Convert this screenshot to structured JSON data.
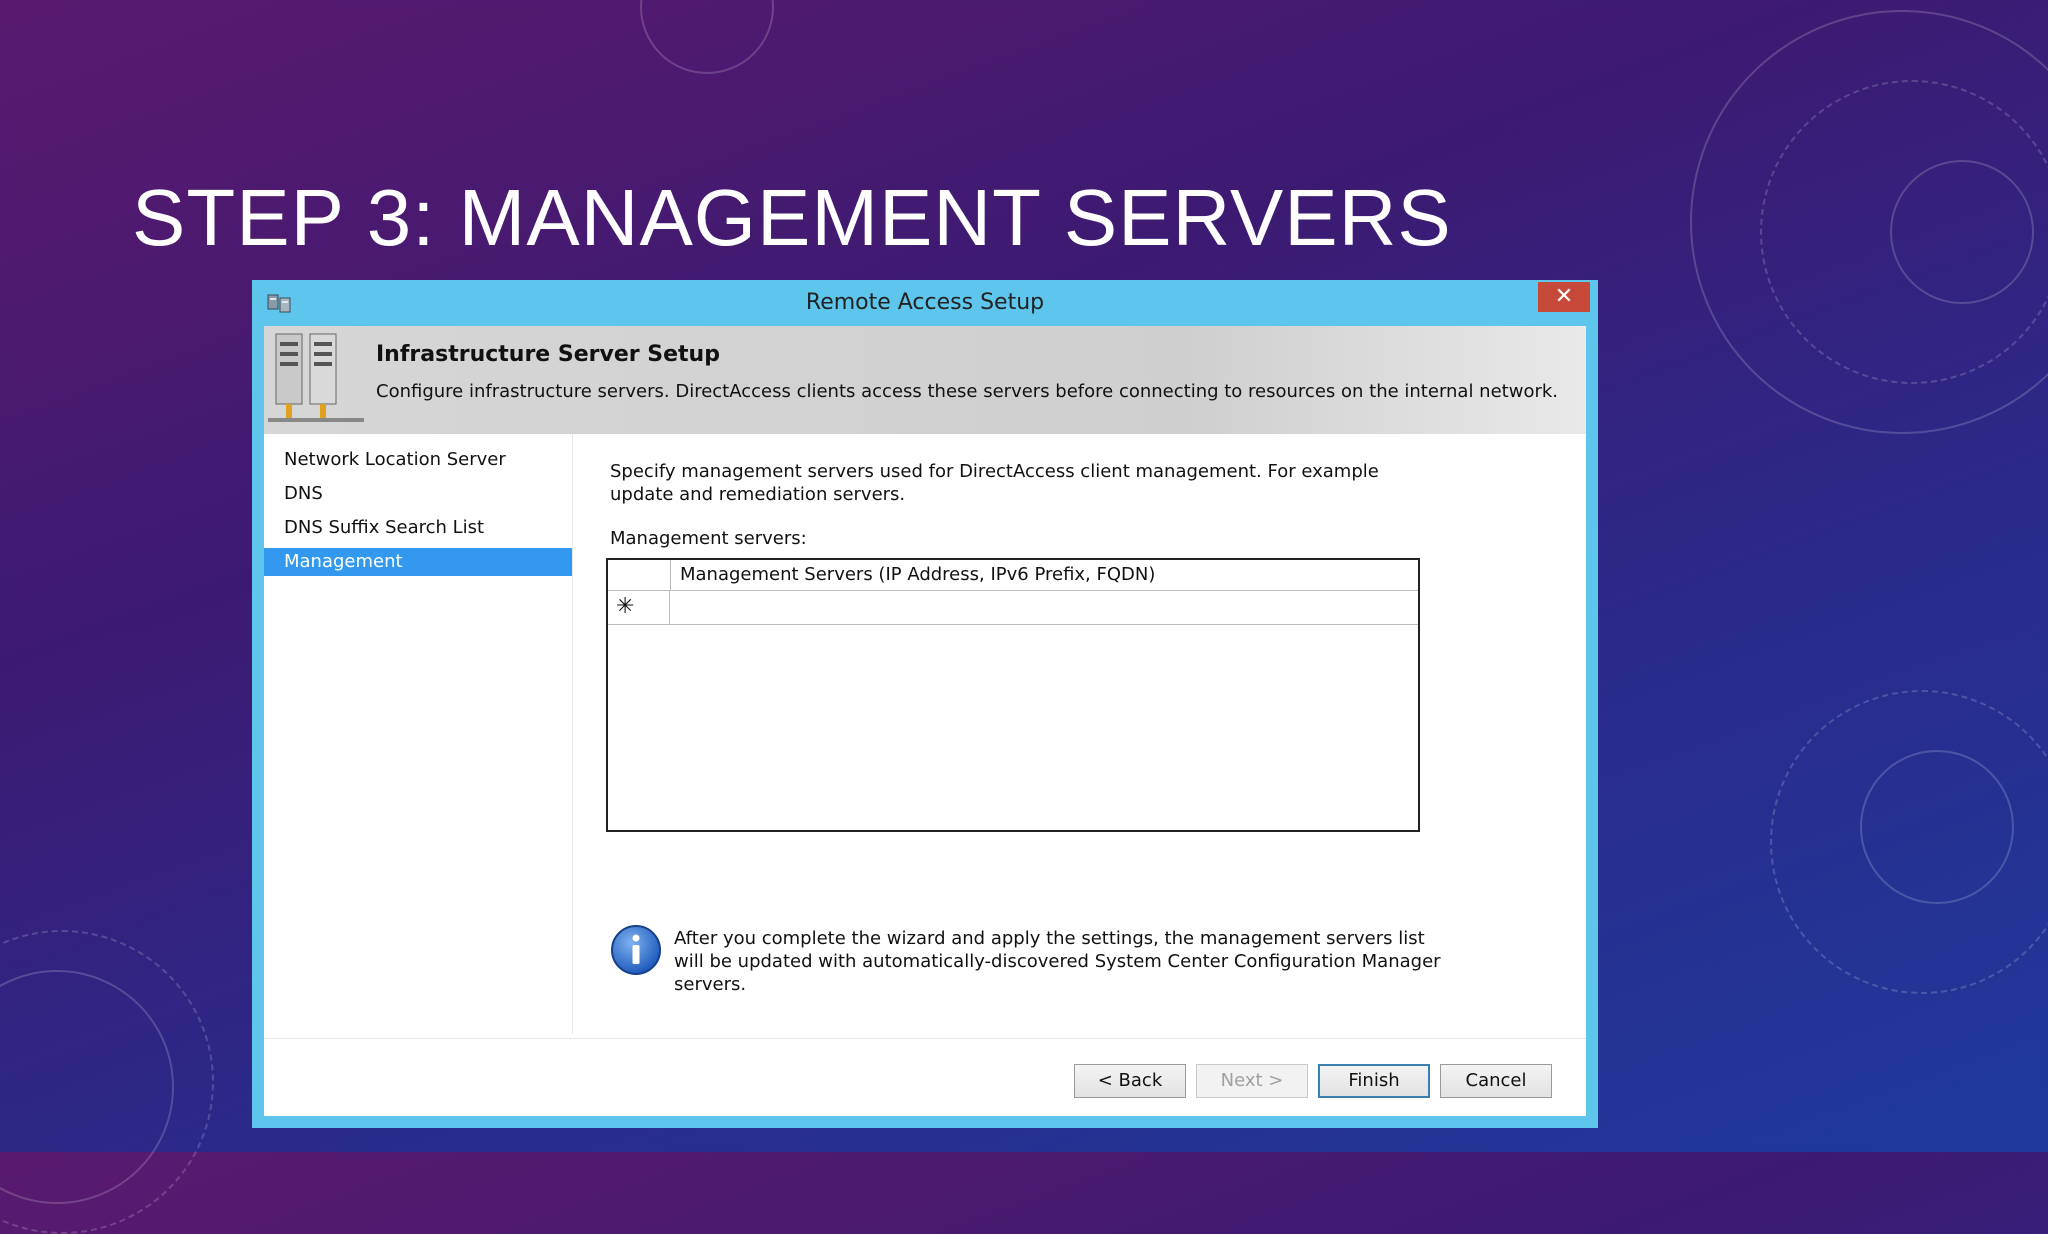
{
  "slide": {
    "title": "STEP 3: MANAGEMENT SERVERS"
  },
  "window": {
    "title": "Remote Access Setup",
    "close_label": "✕"
  },
  "banner": {
    "title": "Infrastructure Server Setup",
    "description": "Configure infrastructure servers. DirectAccess clients access these servers before connecting to resources on the internal network."
  },
  "nav": {
    "items": [
      {
        "label": "Network Location Server"
      },
      {
        "label": "DNS"
      },
      {
        "label": "DNS Suffix Search List"
      },
      {
        "label": "Management"
      }
    ],
    "active": "Management"
  },
  "content": {
    "description": "Specify management servers used for DirectAccess client management. For example update and remediation servers.",
    "servers_label": "Management servers:",
    "grid": {
      "column_header": "Management Servers (IP Address, IPv6 Prefix, FQDN)",
      "new_row_marker": "✳",
      "rows": []
    },
    "info_text": "After you complete the wizard and apply the settings, the management servers list will be updated with automatically-discovered System Center Configuration Manager servers."
  },
  "buttons": {
    "back": "< Back",
    "next": "Next >",
    "finish": "Finish",
    "cancel": "Cancel"
  },
  "colors": {
    "window_frame": "#5ec6ec",
    "selected_nav": "#3399ee",
    "close_button": "#c7493a"
  }
}
